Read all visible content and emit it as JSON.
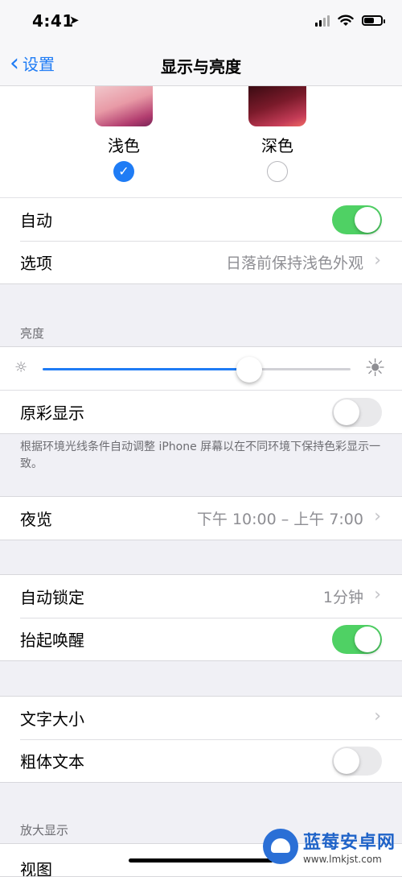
{
  "status_bar": {
    "time": "4:41",
    "location_icon": "location-arrow-icon"
  },
  "nav": {
    "back_label": "设置",
    "title": "显示与亮度"
  },
  "appearance": {
    "light_label": "浅色",
    "dark_label": "深色",
    "selected": "light"
  },
  "auto_group": {
    "automatic_label": "自动",
    "automatic_on": true,
    "options_label": "选项",
    "options_value": "日落前保持浅色外观"
  },
  "brightness": {
    "header": "亮度",
    "level_percent": 67,
    "true_tone_label": "原彩显示",
    "true_tone_on": false,
    "footnote": "根据环境光线条件自动调整 iPhone 屏幕以在不同环境下保持色彩显示一致。"
  },
  "night_shift": {
    "label": "夜览",
    "value": "下午 10:00 – 上午 7:00"
  },
  "lock_group": {
    "auto_lock_label": "自动锁定",
    "auto_lock_value": "1分钟",
    "raise_to_wake_label": "抬起唤醒",
    "raise_to_wake_on": true
  },
  "text_group": {
    "text_size_label": "文字大小",
    "bold_text_label": "粗体文本",
    "bold_text_on": false
  },
  "zoom": {
    "header": "放大显示",
    "view_label": "视图"
  },
  "watermark": {
    "title": "蓝莓安卓网",
    "url": "www.lmkjst.com"
  },
  "colors": {
    "accent": "#1f7cf5",
    "toggle_on": "#4fd164",
    "secondary_text": "#8e8e93"
  }
}
